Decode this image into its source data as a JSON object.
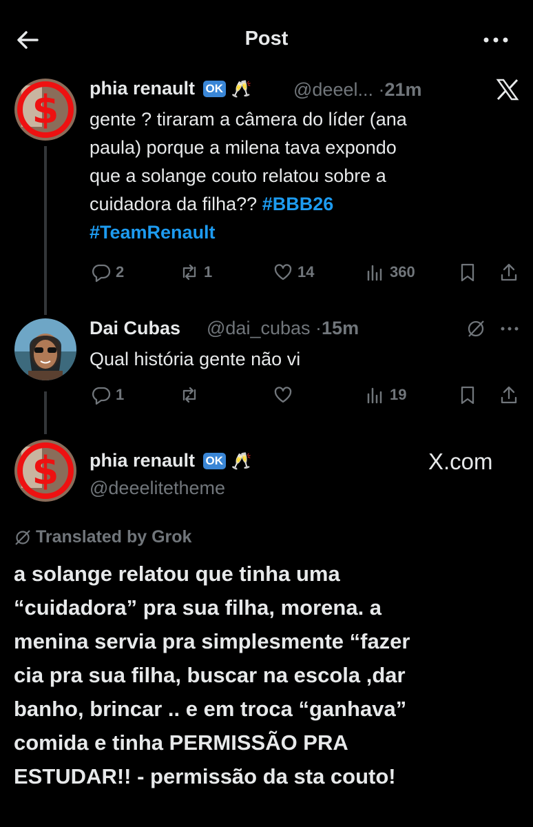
{
  "header": {
    "title": "Post"
  },
  "thread_line_color": "#333639",
  "accent": "#1d9bf0",
  "post1": {
    "name": "phia renault",
    "badge": "OK",
    "handle": "@deeel...",
    "sep": "·",
    "time": "21m",
    "text_lines": [
      "gente ? tiraram a câmera do líder (ana",
      "paula) porque a milena tava expondo",
      "que a solange couto relatou sobre a",
      "cuidadora da filha?? "
    ],
    "hashtags": [
      "#BBB26",
      "#TeamRenault"
    ],
    "replies": "2",
    "reposts": "1",
    "likes": "14",
    "views": "360"
  },
  "post2": {
    "name": "Dai Cubas",
    "handle": "@dai_cubas",
    "sep": "·",
    "time": "15m",
    "text": "Qual história gente não vi",
    "replies": "1",
    "views": "19"
  },
  "post3": {
    "name": "phia renault",
    "badge": "OK",
    "handle": "@deeelitetheme",
    "site": "X.com",
    "grok_label": "Translated by Grok",
    "translated_lines": [
      "a solange relatou que tinha uma",
      "“cuidadora” pra sua filha, morena. a",
      "menina servia pra simplesmente “fazer",
      "cia pra sua filha, buscar na escola ,dar",
      "banho, brincar .. e em troca “ganhava”",
      "comida e tinha PERMISSÃO PRA",
      "ESTUDAR!! - permissão da sta couto!"
    ]
  },
  "icons": [
    "back-arrow-icon",
    "more-icon",
    "x-logo-icon",
    "reply-icon",
    "repost-icon",
    "like-icon",
    "views-icon",
    "bookmark-icon",
    "share-icon",
    "grok-icon",
    "champagne-icon"
  ]
}
